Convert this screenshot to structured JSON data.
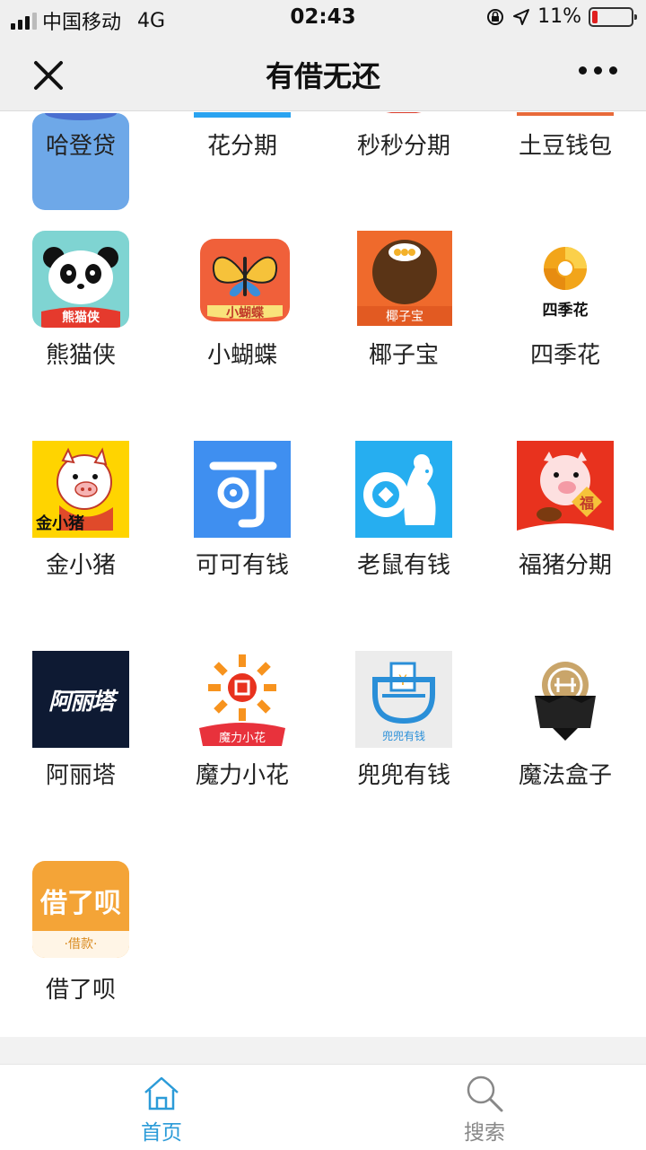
{
  "status_bar": {
    "carrier": "中国移动",
    "network": "4G",
    "time": "02:43",
    "battery_text": "11%"
  },
  "nav": {
    "title": "有借无还"
  },
  "apps": [
    {
      "label": "哈登贷"
    },
    {
      "label": "花分期"
    },
    {
      "label": "秒秒分期"
    },
    {
      "label": "土豆钱包"
    },
    {
      "label": "熊猫侠",
      "icon_text": "熊猫侠"
    },
    {
      "label": "小蝴蝶",
      "icon_text": "小蝴蝶"
    },
    {
      "label": "椰子宝",
      "icon_text": "椰子宝"
    },
    {
      "label": "四季花",
      "icon_text": "四季花"
    },
    {
      "label": "金小猪",
      "icon_text": "金小猪"
    },
    {
      "label": "可可有钱",
      "icon_text": "可"
    },
    {
      "label": "老鼠有钱"
    },
    {
      "label": "福猪分期",
      "icon_text": "福"
    },
    {
      "label": "阿丽塔",
      "icon_text": "阿丽塔"
    },
    {
      "label": "魔力小花",
      "icon_text": "魔力小花"
    },
    {
      "label": "兜兜有钱",
      "icon_text": "兜兜有钱"
    },
    {
      "label": "魔法盒子"
    },
    {
      "label": "借了呗",
      "icon_text": "借了呗",
      "icon_subtext": "·借款·"
    }
  ],
  "tabs": [
    {
      "label": "首页",
      "icon": "home-icon",
      "active": true
    },
    {
      "label": "搜索",
      "icon": "search-icon",
      "active": false
    }
  ],
  "colors": {
    "active_tab": "#2b9bd8",
    "inactive_tab": "#888888",
    "battery_low": "#e02020"
  }
}
